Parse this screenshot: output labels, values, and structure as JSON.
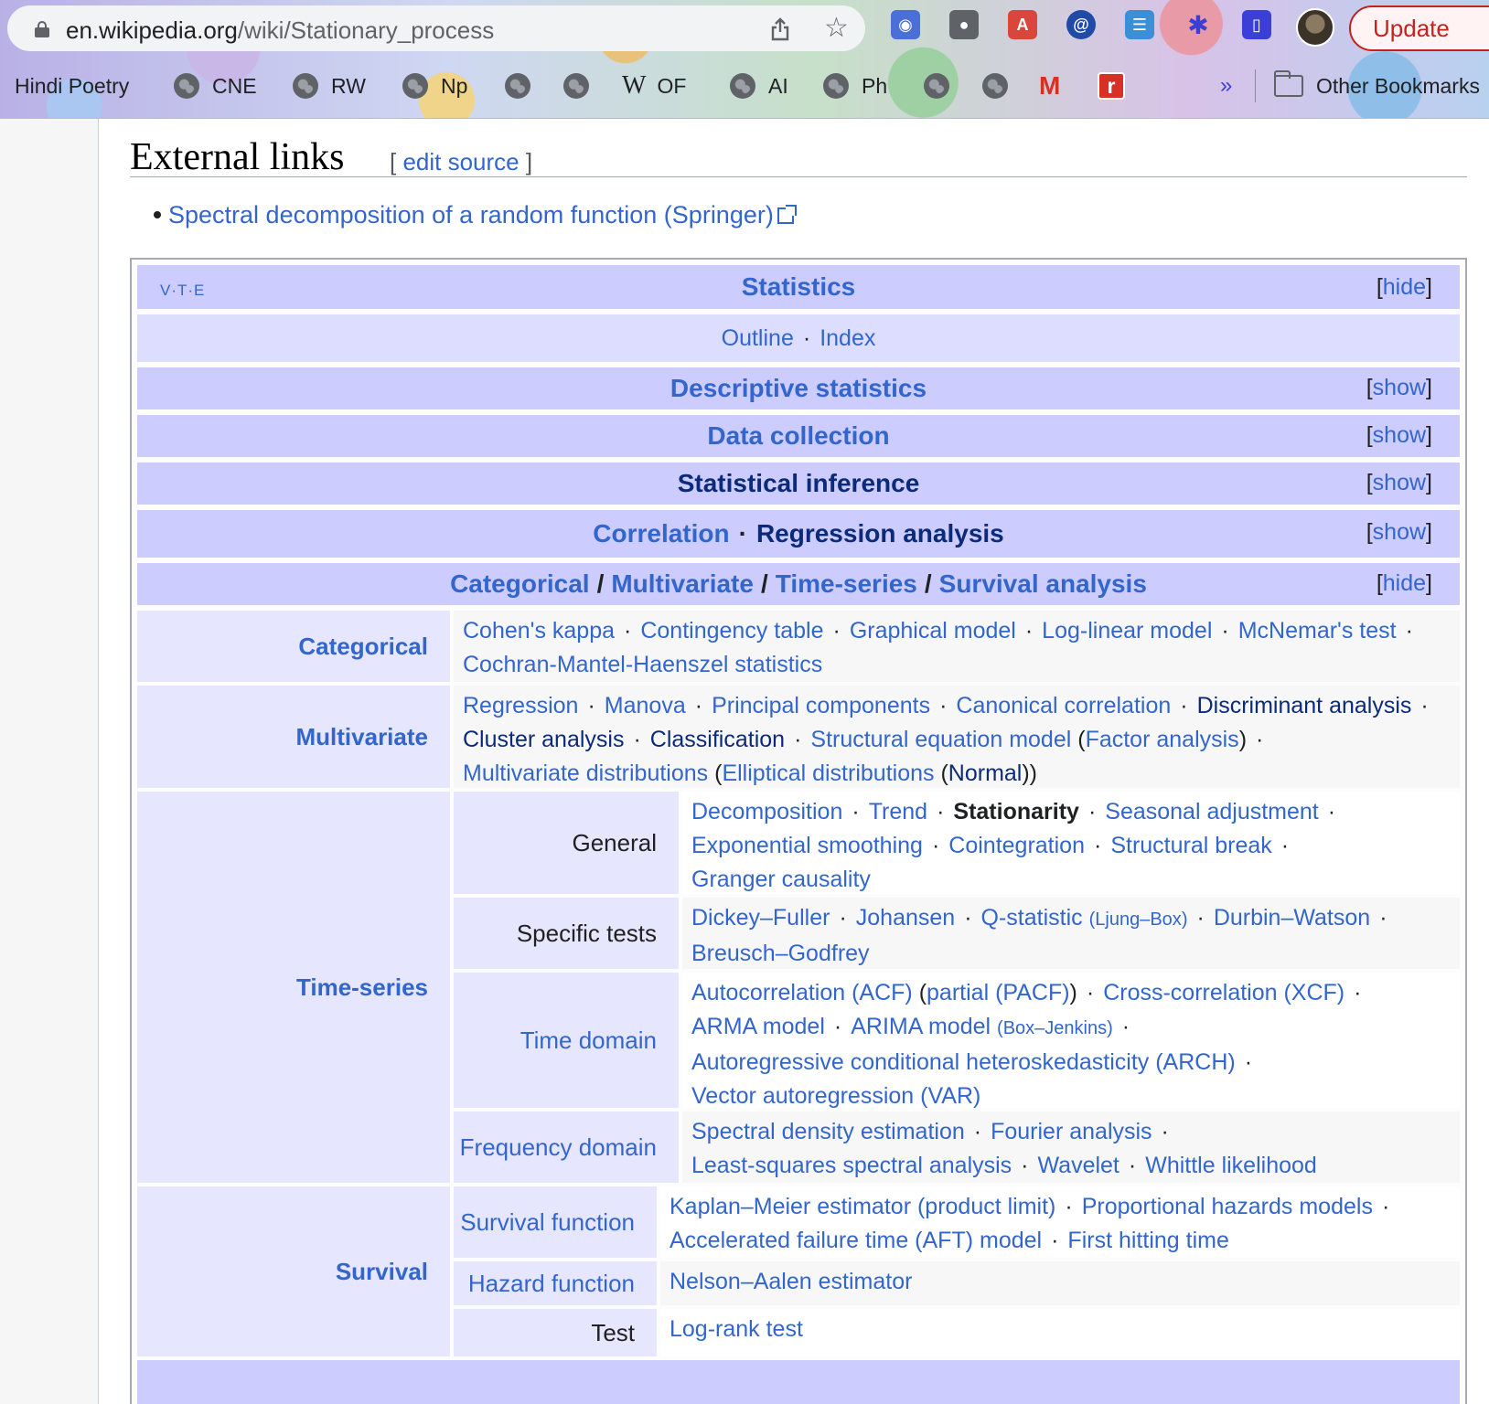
{
  "browser": {
    "url_host": "en.wikipedia.org",
    "url_path": "/wiki/Stationary_process",
    "update_label": "Update",
    "bookmarks": [
      {
        "label": "Hindi Poetry",
        "icon": "none"
      },
      {
        "label": "CNE",
        "icon": "globe-icon"
      },
      {
        "label": "RW",
        "icon": "globe-icon"
      },
      {
        "label": "Np",
        "icon": "globe-icon"
      },
      {
        "label": "",
        "icon": "globe-icon"
      },
      {
        "label": "",
        "icon": "globe-icon"
      },
      {
        "label": "OF",
        "icon": "wikipedia-icon"
      },
      {
        "label": "AI",
        "icon": "globe-icon"
      },
      {
        "label": "Ph",
        "icon": "globe-icon"
      },
      {
        "label": "",
        "icon": "globe-icon"
      },
      {
        "label": "",
        "icon": "globe-icon"
      },
      {
        "label": "",
        "icon": "gmail-icon"
      },
      {
        "label": "",
        "icon": "r-icon"
      }
    ],
    "more_label": "»",
    "other_bookmarks": "Other Bookmarks"
  },
  "article": {
    "section_title": "External links",
    "edit_open": "[ ",
    "edit_label": "edit source",
    "edit_close": " ]",
    "external_link": "Spectral decomposition of a random function (Springer)"
  },
  "navbox": {
    "vte": "V·T·E",
    "title": "Statistics",
    "hide": "hide",
    "show": "show",
    "outline": "Outline",
    "index": "Index",
    "rows": {
      "descriptive": "Descriptive statistics",
      "data_collection": "Data collection",
      "inference": "Statistical inference",
      "correlation": "Correlation",
      "regression": "Regression analysis",
      "categorical": "Categorical",
      "multivariate": "Multivariate",
      "time_series": "Time-series",
      "survival": "Survival analysis"
    },
    "groups": {
      "categorical": "Categorical",
      "multivariate": "Multivariate",
      "time_series": "Time-series",
      "survival": "Survival",
      "general": "General",
      "specific_tests": "Specific tests",
      "time_domain": "Time domain",
      "frequency_domain": "Frequency domain",
      "survival_function": "Survival function",
      "hazard_function": "Hazard function",
      "test": "Test"
    },
    "lists": {
      "categorical": [
        "Cohen's kappa",
        "Contingency table",
        "Graphical model",
        "Log-linear model",
        "McNemar's test",
        "Cochran-Mantel-Haenszel statistics"
      ],
      "multivariate": [
        "Regression",
        "Manova",
        "Principal components",
        "Canonical correlation",
        "Discriminant analysis",
        "Cluster analysis",
        "Classification",
        "Structural equation model",
        "Factor analysis",
        "Multivariate distributions",
        "Elliptical distributions",
        "Normal"
      ],
      "general": [
        "Decomposition",
        "Trend",
        "Stationarity",
        "Seasonal adjustment",
        "Exponential smoothing",
        "Cointegration",
        "Structural break",
        "Granger causality"
      ],
      "specific_tests": [
        "Dickey–Fuller",
        "Johansen",
        "Q-statistic",
        "Ljung–Box",
        "Durbin–Watson",
        "Breusch–Godfrey"
      ],
      "time_domain": [
        "Autocorrelation (ACF)",
        "partial (PACF)",
        "Cross-correlation (XCF)",
        "ARMA model",
        "ARIMA model",
        "Box–Jenkins",
        "Autoregressive conditional heteroskedasticity (ARCH)",
        "Vector autoregression (VAR)"
      ],
      "frequency_domain": [
        "Spectral density estimation",
        "Fourier analysis",
        "Least-squares spectral analysis",
        "Wavelet",
        "Whittle likelihood"
      ],
      "survival_function": [
        "Kaplan–Meier estimator (product limit)",
        "Proportional hazards models",
        "Accelerated failure time (AFT) model",
        "First hitting time"
      ],
      "hazard_function": [
        "Nelson–Aalen estimator"
      ],
      "test": [
        "Log-rank test"
      ]
    }
  }
}
